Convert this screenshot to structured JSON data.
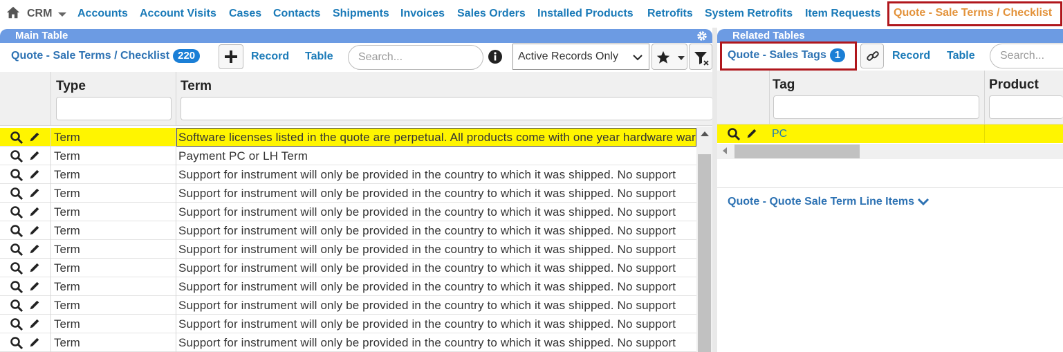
{
  "nav": {
    "crm_label": "CRM",
    "links": [
      "Accounts",
      "Account Visits",
      "Cases",
      "Contacts",
      "Shipments",
      "Invoices",
      "Sales Orders",
      "Installed Products",
      "Retrofits",
      "System Retrofits",
      "Item Requests"
    ],
    "active": "Quote - Sale Terms / Checklist"
  },
  "main": {
    "bar_title": "Main Table",
    "title": "Quote - Sale Terms / Checklist",
    "count": "220",
    "record_label": "Record",
    "table_label": "Table",
    "search_placeholder": "Search...",
    "filter_select": "Active Records Only",
    "columns": [
      "Type",
      "Term"
    ],
    "rows": [
      {
        "type": "Term",
        "term": "Software licenses listed in the quote are perpetual. All products come with one year hardware warranty"
      },
      {
        "type": "Term",
        "term": "Payment PC or LH Term"
      },
      {
        "type": "Term",
        "term": "Support for instrument will only be provided in the country to which it was shipped. No support"
      },
      {
        "type": "Term",
        "term": "Support for instrument will only be provided in the country to which it was shipped. No support"
      },
      {
        "type": "Term",
        "term": "Support for instrument will only be provided in the country to which it was shipped. No support"
      },
      {
        "type": "Term",
        "term": "Support for instrument will only be provided in the country to which it was shipped. No support"
      },
      {
        "type": "Term",
        "term": "Support for instrument will only be provided in the country to which it was shipped. No support"
      },
      {
        "type": "Term",
        "term": "Support for instrument will only be provided in the country to which it was shipped. No support"
      },
      {
        "type": "Term",
        "term": "Support for instrument will only be provided in the country to which it was shipped. No support"
      },
      {
        "type": "Term",
        "term": "Support for instrument will only be provided in the country to which it was shipped. No support"
      },
      {
        "type": "Term",
        "term": "Support for instrument will only be provided in the country to which it was shipped. No support"
      },
      {
        "type": "Term",
        "term": "Support for instrument will only be provided in the country to which it was shipped. No support"
      }
    ]
  },
  "related": {
    "bar_title": "Related Tables",
    "title": "Quote - Sales Tags",
    "count": "1",
    "record_label": "Record",
    "table_label": "Table",
    "search_placeholder": "Search...",
    "columns": [
      "Tag",
      "Product"
    ],
    "rows": [
      {
        "tag": "PC",
        "product": ""
      }
    ],
    "sub_section": "Quote - Quote Sale Term Line Items"
  },
  "colors": {
    "accent": "#1a7ab8",
    "bar": "#6c9be3",
    "selected_row": "#fff500",
    "active_tab": "#e3923a",
    "highlight_box": "#b0161c"
  }
}
